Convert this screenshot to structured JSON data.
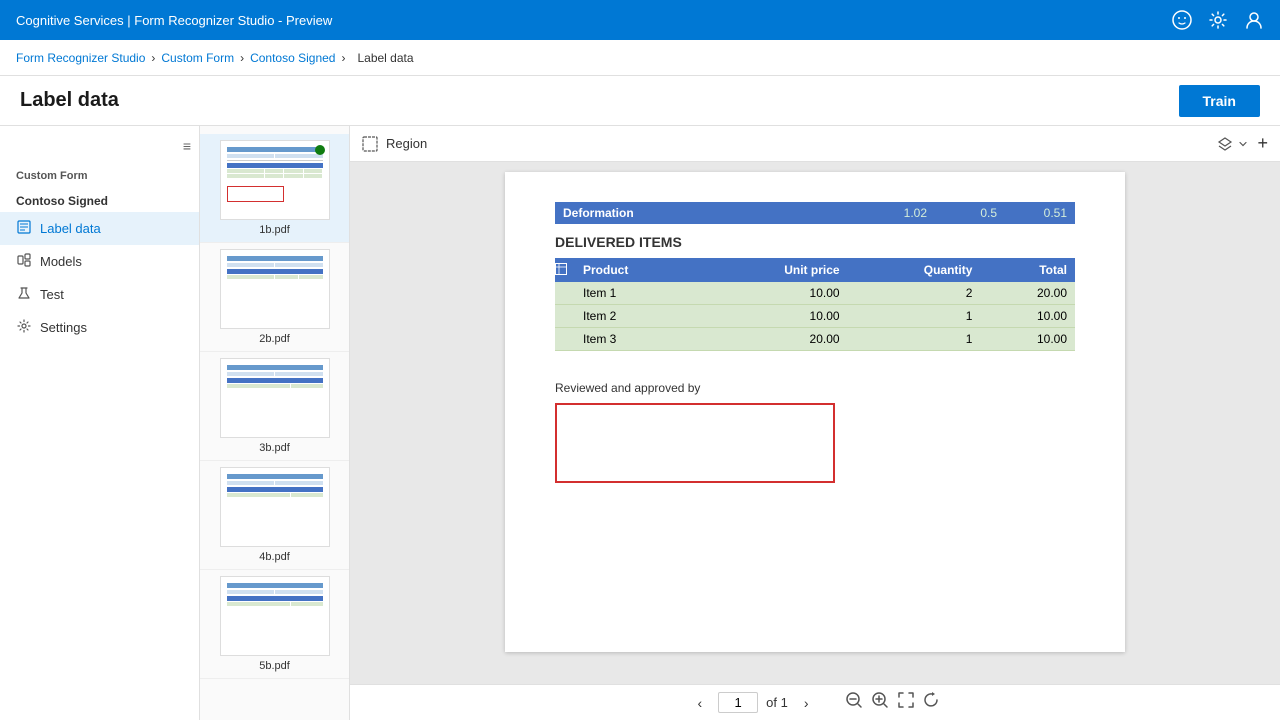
{
  "topbar": {
    "title": "Cognitive Services | Form Recognizer Studio - Preview",
    "icons": [
      "emoji-icon",
      "settings-icon",
      "user-icon"
    ]
  },
  "breadcrumb": {
    "items": [
      "Form Recognizer Studio",
      "Custom Form",
      "Contoso Signed",
      "Label data"
    ],
    "separators": [
      "›",
      "›",
      "›"
    ]
  },
  "page": {
    "title": "Label data",
    "train_button": "Train"
  },
  "sidebar": {
    "collapse_label": "≡",
    "group_title": "Custom Form",
    "section_title": "Contoso Signed",
    "items": [
      {
        "id": "label-data",
        "label": "Label data",
        "icon": "📄",
        "active": true
      },
      {
        "id": "models",
        "label": "Models",
        "icon": "🗂"
      },
      {
        "id": "test",
        "label": "Test",
        "icon": "🧪"
      },
      {
        "id": "settings",
        "label": "Settings",
        "icon": "⚙"
      }
    ]
  },
  "file_list": {
    "files": [
      {
        "name": "1b.pdf",
        "selected": true,
        "has_indicator": true
      },
      {
        "name": "2b.pdf",
        "selected": false,
        "has_indicator": false
      },
      {
        "name": "3b.pdf",
        "selected": false,
        "has_indicator": false
      },
      {
        "name": "4b.pdf",
        "selected": false,
        "has_indicator": false
      },
      {
        "name": "5b.pdf",
        "selected": false,
        "has_indicator": false
      }
    ]
  },
  "toolbar": {
    "region_label": "Region",
    "layer_icon": "layers",
    "add_icon": "+"
  },
  "document": {
    "deformation": {
      "label": "Deformation",
      "values": [
        "1.02",
        "0.5",
        "0.51"
      ]
    },
    "delivered_items_title": "DELIVERED ITEMS",
    "table_headers": [
      "Product",
      "Unit price",
      "Quantity",
      "Total"
    ],
    "table_rows": [
      {
        "product": "Item 1",
        "unit_price": "10.00",
        "quantity": "2",
        "total": "20.00"
      },
      {
        "product": "Item 2",
        "unit_price": "10.00",
        "quantity": "1",
        "total": "10.00"
      },
      {
        "product": "Item 3",
        "unit_price": "20.00",
        "quantity": "1",
        "total": "10.00"
      }
    ],
    "reviewed_label": "Reviewed and approved by",
    "signature_box_placeholder": ""
  },
  "pagination": {
    "current_page": "1",
    "total_pages": "1",
    "of_label": "of"
  },
  "colors": {
    "topbar_bg": "#0078d4",
    "table_header_bg": "#4472c4",
    "table_row_bg": "#d9e8d0",
    "deformation_bg": "#4472c4",
    "signature_border": "#d32f2f",
    "active_nav": "#e6f2fb",
    "indicator_green": "#107c10"
  }
}
